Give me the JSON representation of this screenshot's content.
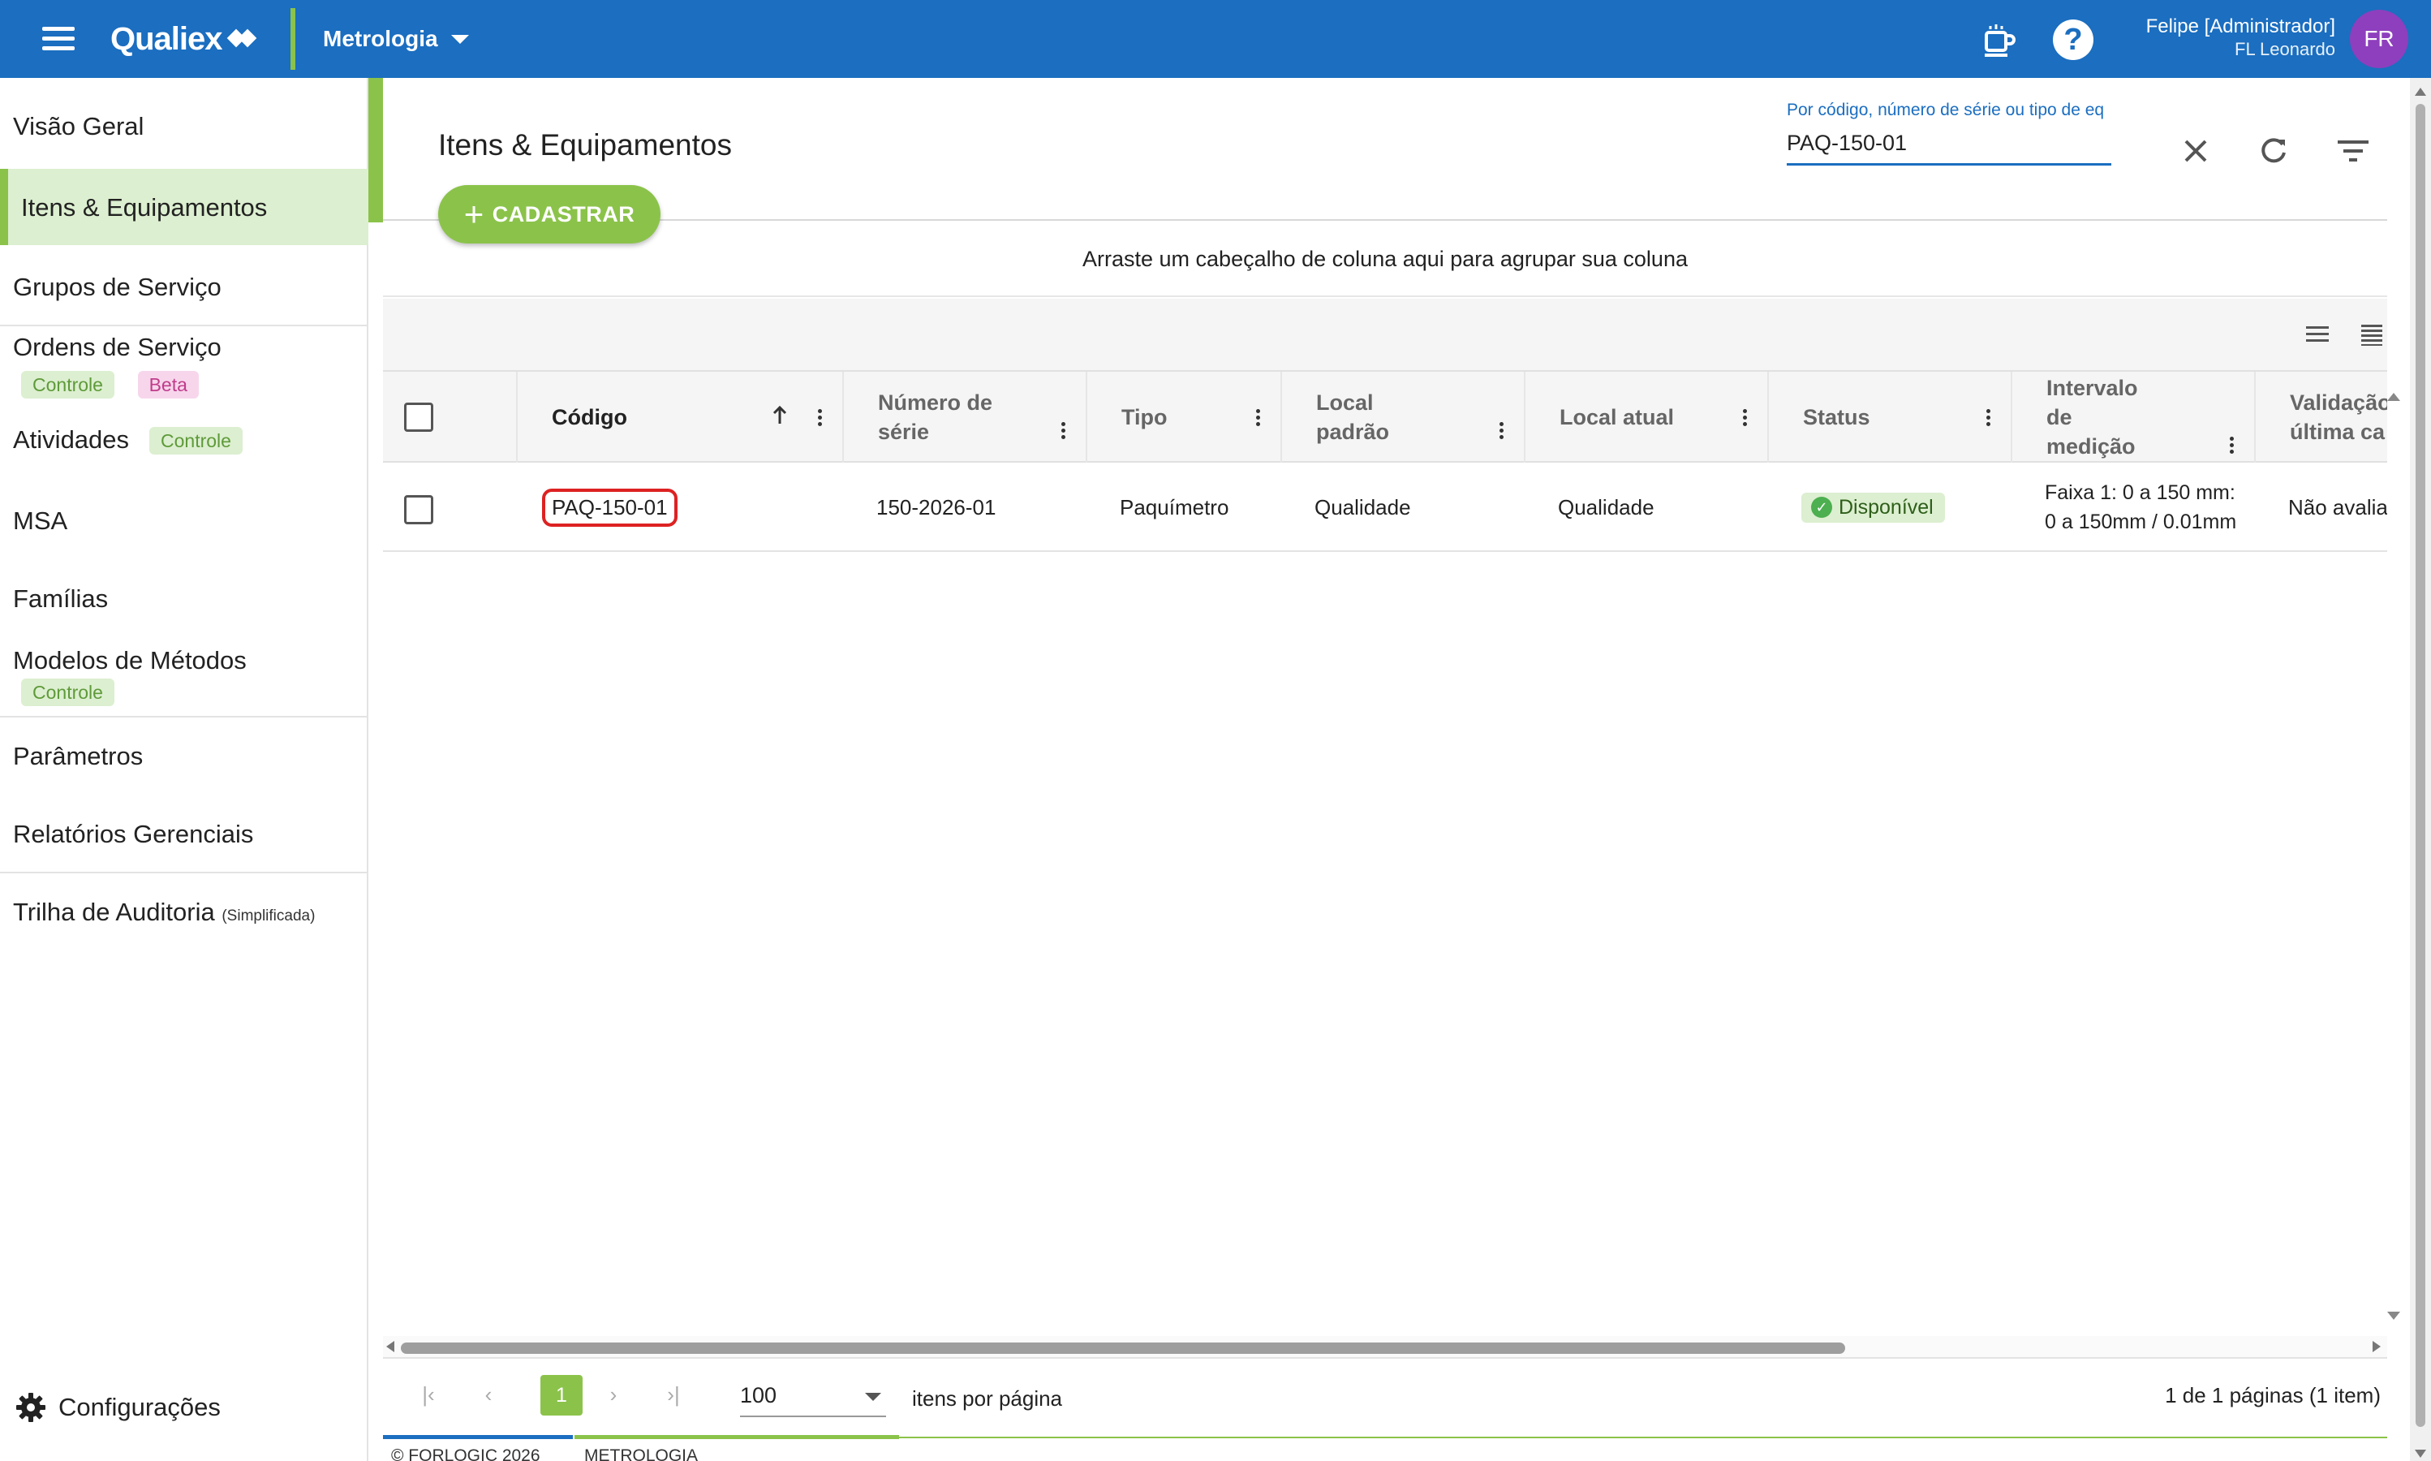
{
  "topbar": {
    "brand": "Qualiex",
    "module": "Metrologia",
    "user_name": "Felipe [Administrador]",
    "user_org": "FL Leonardo",
    "avatar_initials": "FR",
    "help_glyph": "?"
  },
  "sidebar": {
    "items": [
      {
        "label": "Visão Geral"
      },
      {
        "label": "Itens & Equipamentos"
      },
      {
        "label": "Grupos de Serviço"
      },
      {
        "label": "Ordens de Serviço",
        "tags": [
          "Controle",
          "Beta"
        ]
      },
      {
        "label": "Atividades",
        "tags": [
          "Controle"
        ]
      },
      {
        "label": "MSA"
      },
      {
        "label": "Famílias"
      },
      {
        "label": "Modelos de Métodos",
        "tags": [
          "Controle"
        ]
      },
      {
        "label": "Parâmetros"
      },
      {
        "label": "Relatórios Gerenciais"
      },
      {
        "label": "Trilha de Auditoria",
        "note": "(Simplificada)"
      }
    ],
    "settings": "Configurações"
  },
  "main": {
    "title": "Itens & Equipamentos",
    "search_label": "Por código, número de série ou tipo de eq",
    "search_value": "PAQ-150-01",
    "add_button": "CADASTRAR",
    "group_hint": "Arraste um cabeçalho de coluna aqui para agrupar sua coluna"
  },
  "table": {
    "columns": [
      "Código",
      "Número de série",
      "Tipo",
      "Local padrão",
      "Local atual",
      "Status",
      "Intervalo de medição",
      "Validação última ca"
    ],
    "rows": [
      {
        "codigo": "PAQ-150-01",
        "serie": "150-2026-01",
        "tipo": "Paquímetro",
        "local_padrao": "Qualidade",
        "local_atual": "Qualidade",
        "status": "Disponível",
        "intervalo": "Faixa 1: 0 a 150 mm: 0 a 150mm / 0.01mm",
        "validacao": "Não avalia"
      }
    ]
  },
  "pager": {
    "current_page": "1",
    "page_size": "100",
    "per_page_label": "itens por página",
    "summary": "1 de 1 páginas (1 item)"
  },
  "footer": {
    "copyright": "© FORLOGIC 2026",
    "module": "METROLOGIA"
  },
  "colors": {
    "topbar": "#1b6ec0",
    "accent_green": "#8bc34a",
    "avatar": "#8e3fbd",
    "highlight": "#dd2222"
  }
}
